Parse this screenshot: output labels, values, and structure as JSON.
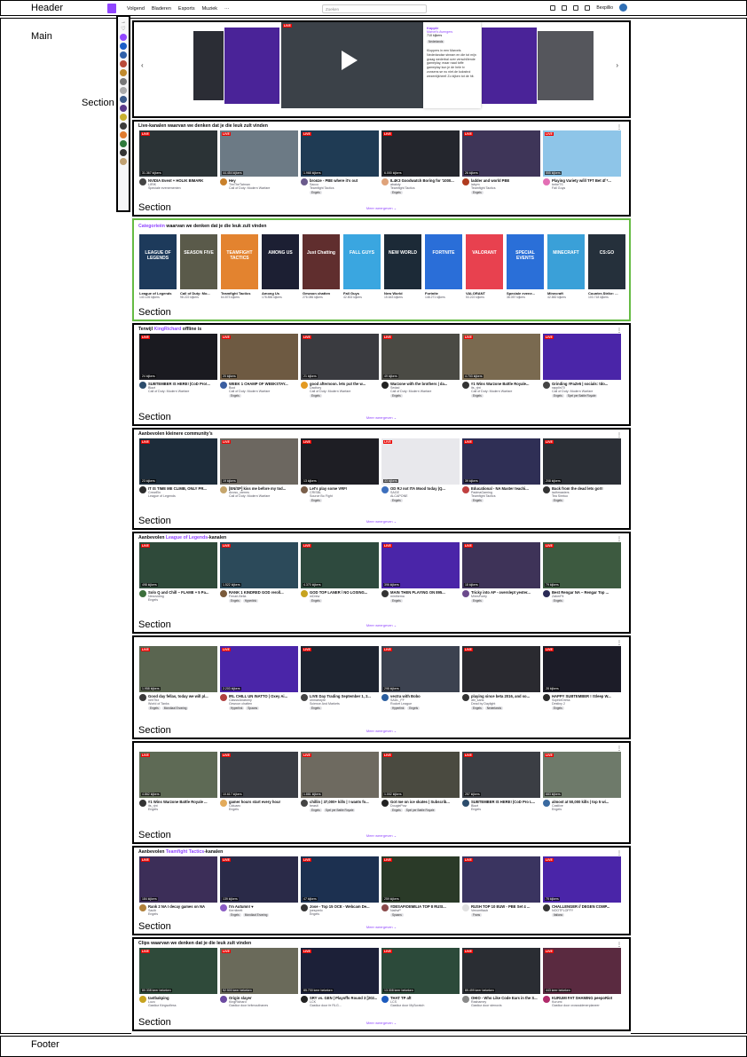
{
  "labels": {
    "header": "Header",
    "main": "Main",
    "footer": "Footer",
    "section": "Section"
  },
  "nav": {
    "items": [
      "Volgend",
      "Bladeren",
      "Esports",
      "Muziek",
      "···"
    ],
    "search_placeholder": "Zoeken",
    "user": "Bexpillio"
  },
  "carousel": {
    "streamer": "Kapple",
    "game": "Marvel's Avengers",
    "viewers": "710 kijkers",
    "tag": "Nederlands",
    "description": "Kloppers in een Marvels Nederlandse stream en die tot mijn graag wederbal over verschillende gameplay, maar raad toffe gameplay kun je de hele tv zonsens se nu niet.de kolostroi wezenlijkheel! Zo kijken tot de hit."
  },
  "sections": [
    {
      "title_pre": "Live-kanalen waarvan we denken dat je die leuk zult vinden",
      "title_hl": "",
      "title_post": "",
      "more": "Meer weergeven",
      "cards": [
        {
          "viewers": "31.367 kijkers",
          "title": "NVIDIA Event + HOLIK BIMARK",
          "channel": "LIRIK",
          "game": "Speciale evenementen",
          "tags": [],
          "color": "#2b3336",
          "av": "#444"
        },
        {
          "viewers": "44.454 kijkers",
          "title": "Hey",
          "channel": "TimTheTatman",
          "game": "Call of Duty: Modern Warfare",
          "tags": [],
          "color": "#6c7a85",
          "av": "#c9812c"
        },
        {
          "viewers": "1.968 kijkers",
          "title": "bronze - PBE where it's out",
          "channel": "Sacco",
          "game": "Teamfight Tactics",
          "tags": [
            "Engels"
          ],
          "color": "#1f3b54",
          "av": "#6a5a8c"
        },
        {
          "viewers": "6.000 kijkers",
          "title": "IL4K3 Goodwatch Boring for '1000...",
          "channel": "abakdy",
          "game": "Teamfight Tactics",
          "tags": [
            "Engels"
          ],
          "color": "#24262d",
          "av": "#dfa37a"
        },
        {
          "viewers": "26 kijkers",
          "title": "ladder and world PBE",
          "channel": "labym",
          "game": "Teamfight Tactics",
          "tags": [
            "Engels"
          ],
          "color": "#3e3558",
          "av": "#b03b1f"
        },
        {
          "viewers": "555 kijkers",
          "title": "Playing Variety w/ill TFT Bet 4f *...",
          "channel": "bebeTS",
          "game": "Fall Guys",
          "tags": [],
          "color": "#8ec5e8",
          "av": "#e36fb5"
        }
      ]
    }
  ],
  "categories": {
    "title_hl": "Categorieën",
    "title_post": " waarvan we denken dat je die leuk zult vinden",
    "items": [
      {
        "name": "League of Legends",
        "viewers": "140.126 kijkers",
        "color": "#1d3a5b",
        "art": "LEAGUE OF LEGENDS"
      },
      {
        "name": "Call of Duty: Mo...",
        "viewers": "98.222 kijkers",
        "color": "#5a5a4a",
        "art": "SEASON FIVE"
      },
      {
        "name": "Teamfight Tactics",
        "viewers": "64.873 kijkers",
        "color": "#e3832f",
        "art": "TEAMFIGHT TACTICS"
      },
      {
        "name": "Among Us",
        "viewers": "178.856 kijkers",
        "color": "#1c1f33",
        "art": "AMONG US"
      },
      {
        "name": "Gewoon chatten",
        "viewers": "276.086 kijkers",
        "color": "#602e2e",
        "art": "Just Chatting"
      },
      {
        "name": "Fall Guys",
        "viewers": "42.802 kijkers",
        "color": "#3aa6e0",
        "art": "FALL GUYS"
      },
      {
        "name": "New World",
        "viewers": "15.643 kijkers",
        "color": "#1c2a37",
        "art": "NEW WORLD"
      },
      {
        "name": "Fortnite",
        "viewers": "148.271 kijkers",
        "color": "#2a6ed8",
        "art": "FORTNITE"
      },
      {
        "name": "VALORANT",
        "viewers": "53.222 kijkers",
        "color": "#e8414f",
        "art": "VALORANT"
      },
      {
        "name": "Speciale evene...",
        "viewers": "38.057 kijkers",
        "color": "#2a6fd8",
        "art": "SPECIAL EVENTS"
      },
      {
        "name": "Minecraft",
        "viewers": "42.882 kijkers",
        "color": "#3aa0d8",
        "art": "MINECRAFT"
      },
      {
        "name": "Counter-Strike: ...",
        "viewers": "103.718 kijkers",
        "color": "#25303b",
        "art": "CS:GO"
      }
    ]
  },
  "rows": [
    {
      "title_pre": "Terwijl ",
      "title_hl": "KingRichard",
      "title_post": " offline is",
      "more": "Meer weergeven",
      "cards": [
        {
          "viewers": "24 kijkers",
          "title": "SUBTEMBER IS HERE! |CoD Pro!...",
          "channel": "Biazt",
          "game": "Call of Duty: Modern Warfare",
          "tags": [],
          "color": "#1a1a20",
          "av": "#2c4c6c"
        },
        {
          "viewers": "20 kijkers",
          "title": "WEEK 1 CHAMP OF WEEKSTAY...",
          "channel": "Booi",
          "game": "Call of Duty: Modern Warfare",
          "tags": [
            "Engels"
          ],
          "color": "#6e5a42",
          "av": "#3a5ea0"
        },
        {
          "viewers": "21 kijkers",
          "title": "good afternoon. lets put the w...",
          "channel": "Dacitory",
          "game": "Call of Duty: Modern Warfare",
          "tags": [
            "Engels"
          ],
          "color": "#3a3b40",
          "av": "#e39a22"
        },
        {
          "viewers": "49 kijkers",
          "title": "Warzone with the brothers | da...",
          "channel": "Sedad",
          "game": "Call of Duty: Modern Warfare",
          "tags": [
            "Engels"
          ],
          "color": "#4a4a44",
          "av": "#222"
        },
        {
          "viewers": "4.703 kijkers",
          "title": "#1 Wins Warzone Battle Royale...",
          "channel": "its_rjnt",
          "game": "Call of Duty: Modern Warfare",
          "tags": [
            "Engels"
          ],
          "color": "#7a6a50",
          "av": "#333"
        },
        {
          "viewers": "",
          "title": "Grinding #FaZe5 | socials: tdo...",
          "channel": "rapplin70",
          "game": "Call of Duty: Modern Warfare",
          "tags": [
            "Engels",
            "Spel per Battle Royale"
          ],
          "color": "#4a25a8",
          "av": "#444"
        }
      ]
    },
    {
      "title_pre": "Aanbevolen kleinere community's",
      "title_hl": "",
      "title_post": "",
      "more": "Meer weergeven",
      "cards": [
        {
          "viewers": "23 kijkers",
          "title": "IT IS TIME ME CLIMB, ONLY PR...",
          "channel": "CrearEin",
          "game": "League of Legends",
          "tags": [],
          "color": "#1d2c3a",
          "av": "#2b2b2b"
        },
        {
          "viewers": "19 kijkers",
          "title": "[EN/SP] kiss me before my tod...",
          "channel": "Anosu_xterms",
          "game": "Call of Duty: Modern Warfare",
          "tags": [],
          "color": "#6c6760",
          "av": "#c5a56c"
        },
        {
          "viewers": "13 kijkers",
          "title": "Let's play some VRF!",
          "channel": "CRISBL",
          "game": "Source Bo Fight",
          "tags": [
            "Engels"
          ],
          "color": "#1e1e24",
          "av": "#7a5f4a"
        },
        {
          "viewers": "33 kijkers",
          "title": "OD RJ not ITA Mood today (Q...",
          "channel": "SAGE",
          "game": "ALCAPONE",
          "tags": [
            "Engels"
          ],
          "color": "#e8e8ec",
          "av": "#3d6fbd"
        },
        {
          "viewers": "39 kijkers",
          "title": "Educational - NA Master teachi...",
          "channel": "PadmaGaming",
          "game": "Teamfight Tactics",
          "tags": [
            "Engels"
          ],
          "color": "#2f2f55",
          "av": "#c04040"
        },
        {
          "viewers": "208 kijkers",
          "title": "Back from the dead lets go!!!",
          "channel": "iadhmasters",
          "game": "Tea Simtuo",
          "tags": [
            "Engels"
          ],
          "color": "#2b2f36",
          "av": "#333"
        }
      ]
    },
    {
      "title_pre": "Aanbevolen ",
      "title_hl": "League of Legends",
      "title_post": "-kanalen",
      "more": "Meer weergeven",
      "cards": [
        {
          "viewers": "498 kijkers",
          "title": "Solo Q and Chill ~ FLAME + 5 Pa...",
          "channel": "Nexoviding",
          "game": "Engels",
          "tags": [],
          "color": "#2f4a3a",
          "av": "#3c6f3c"
        },
        {
          "viewers": "1.522 kijkers",
          "title": "RANK 1 KINDRED GOD reroll...",
          "channel": "Fenari-Bella",
          "game": "",
          "tags": [
            "Engels",
            "Hyperlink"
          ],
          "color": "#2c4a5a",
          "av": "#7a5a3a"
        },
        {
          "viewers": "4.370 kijkers",
          "title": "GOD TOP LANER / NO LOSING...",
          "channel": "mDrew",
          "game": "",
          "tags": [
            "Engels"
          ],
          "color": "#2e4a3e",
          "av": "#c7a31f"
        },
        {
          "viewers": "396 kijkers",
          "title": "MAIN THEN PLAYING ON 895...",
          "channel": "minthema",
          "game": "",
          "tags": [
            "Engels"
          ],
          "color": "#4a25a8",
          "av": "#333"
        },
        {
          "viewers": "18 kijkers",
          "title": "Tricky into AP - overslept yester...",
          "channel": "MiresPoety",
          "game": "",
          "tags": [
            "Engels"
          ],
          "color": "#3e3358",
          "av": "#6b4a8c"
        },
        {
          "viewers": "79 kijkers",
          "title": "Best Rengar NA ~ Rengar Top ...",
          "channel": "ZaberFit",
          "game": "",
          "tags": [
            "Engels"
          ],
          "color": "#3d5a40",
          "av": "#2a2a55"
        }
      ]
    },
    {
      "title_pre": "",
      "title_hl": "",
      "title_post": "",
      "more": "Meer weergeven",
      "cards": [
        {
          "viewers": "1.958 kijkers",
          "title": "Good day fellas, today we will pl...",
          "channel": "nehTtrz",
          "game": "World of Tanks",
          "tags": [
            "Engels",
            "Mondiaal Ervaring"
          ],
          "color": "#5a6550",
          "av": "#3a3a3a"
        },
        {
          "viewers": "2.203 kijkers",
          "title": "IRL CHILL UN INATTO | Oxey Ai...",
          "channel": "ClassicAnatomy",
          "game": "Gewoon chatten",
          "tags": [
            "Hyperlink",
            "Spaans"
          ],
          "color": "#4a25a8",
          "av": "#b04040"
        },
        {
          "viewers": "",
          "title": "LIVE Day Trading September 1, 2...",
          "channel": "ohmarstyre",
          "game": "Science And Markets",
          "tags": [
            "Engels"
          ],
          "color": "#1e2430",
          "av": "#444"
        },
        {
          "viewers": "298 kijkers",
          "title": "vectra with Bobo",
          "channel": "SADL_FF",
          "game": "Rocket League",
          "tags": [
            "Hyperlink",
            "Engels"
          ],
          "color": "#3c4250",
          "av": "#2a5ea0"
        },
        {
          "viewers": "",
          "title": "playing since beta 2016, and so...",
          "channel": "dbl_sans",
          "game": "Dead by Daylight",
          "tags": [
            "Engels",
            "Nederlands"
          ],
          "color": "#2a2a30",
          "av": "#333"
        },
        {
          "viewers": "28 kijkers",
          "title": "HAPPY SUBTEMBER ! !Sleep W...",
          "channel": "SophieDress",
          "game": "Destiny 2",
          "tags": [
            "Engels"
          ],
          "color": "#1c1c28",
          "av": "#2a2a2a"
        }
      ]
    },
    {
      "title_pre": "",
      "title_hl": "",
      "title_post": "",
      "more": "Meer weergeven",
      "cards": [
        {
          "viewers": "4.862 kijkers",
          "title": "#1 Wins Warzone Battle Royale ...",
          "channel": "its_rjnt",
          "game": "Engels",
          "tags": [],
          "color": "#5e6a55",
          "av": "#333"
        },
        {
          "viewers": "10.617 kijkers",
          "title": "gamer hours start every hour",
          "channel": "Ciduaec",
          "game": "Engels",
          "tags": [],
          "color": "#3a3d44",
          "av": "#e3ab5c"
        },
        {
          "viewers": "1.881 kijkers",
          "title": "chillin | 37,000+ kills | ! wants fo...",
          "channel": "beasit",
          "game": "",
          "tags": [
            "Engels",
            "Spel per Battle Royale"
          ],
          "color": "#6e6a60",
          "av": "#444"
        },
        {
          "viewers": "1.002 kijkers",
          "title": "Got me on ice skates | Subscrib...",
          "channel": "DougiePow",
          "game": "",
          "tags": [
            "Engels",
            "Spel per Battle Royale"
          ],
          "color": "#4a4a40",
          "av": "#222"
        },
        {
          "viewers": "257 kijkers",
          "title": "SUBTEMBER IS HERE! |CoD Pro L...",
          "channel": "Biazt",
          "game": "Engels",
          "tags": [],
          "color": "#3b3e44",
          "av": "#2c4c6c"
        },
        {
          "viewers": "683 kijkers",
          "title": "almost at 50,000 kills | top 5 wi...",
          "channel": "Castlive",
          "game": "Engels",
          "tags": [],
          "color": "#6e7a6a",
          "av": "#3a6aa0"
        }
      ]
    },
    {
      "title_pre": "Aanbevolen ",
      "title_hl": "Teamfight Tactics",
      "title_post": "-kanalen",
      "more": "Meer weergeven",
      "cards": [
        {
          "viewers": "184 kijkers",
          "title": "Rank 2 NA I decay games on NA",
          "channel": "Sacib",
          "game": "Engels",
          "tags": [],
          "color": "#3c2e58",
          "av": "#b0803a"
        },
        {
          "viewers": "139 kijkers",
          "title": "I'm Autumn! ♥",
          "channel": "Kerniteett",
          "game": "",
          "tags": [
            "Engels",
            "Mondiaal Ervaring"
          ],
          "color": "#2a2a48",
          "av": "#8a5cc4"
        },
        {
          "viewers": "47 kijkers",
          "title": "Jose - Top 15 OCE - Webcam De...",
          "channel": "joesprelo",
          "game": "Engels",
          "tags": [],
          "color": "#1c3050",
          "av": "#333"
        },
        {
          "viewers": "259 kijkers",
          "title": "#DESAFIOEMILIA TOP 8 RUSI...",
          "channel": "NathvP",
          "game": "",
          "tags": [
            "Spaans"
          ],
          "color": "#2a3a28",
          "av": "#8a4a4a"
        },
        {
          "viewers": "",
          "title": "RUSH TOP 10 EUW - PBE Set 4 ...",
          "channel": "Venomftaub",
          "game": "",
          "tags": [
            "Frans"
          ],
          "color": "#3a3460",
          "av": "#e0e0e0"
        },
        {
          "viewers": "75 kijkers",
          "title": "CHALLENGER // DEGEN COMP...",
          "channel": "NOOTFLOFFY",
          "game": "",
          "tags": [
            "Italiano"
          ],
          "color": "#4a25a8",
          "av": "#333"
        }
      ]
    },
    {
      "title_pre": "Clips waarvan we denken dat je die leuk zult vinden",
      "title_hl": "",
      "title_post": "",
      "more": "Meer weergeven",
      "cards": [
        {
          "viewers": "80.338 keer bekeken",
          "title": "tastbakping",
          "channel": "Lozo",
          "game": "Gastloz Kingsofless",
          "tags": [],
          "color": "#2f4a3a",
          "av": "#c7a31f"
        },
        {
          "viewers": "52.500 keer bekeken",
          "title": "Origin slayer",
          "channel": "KingRichard",
          "game": "Gastloz door britmouthanes",
          "tags": [],
          "color": "#6a6a5a",
          "av": "#6b4aa0"
        },
        {
          "viewers": "85.730 keer bekeken",
          "title": "SRY vs. GEN | Playoffs Round 3 [202...",
          "channel": "LCK",
          "game": "Gastloz door fe RLG...",
          "tags": [],
          "color": "#1c2038",
          "av": "#222"
        },
        {
          "viewers": "13.308 keer bekeken",
          "title": "THAT TP aft",
          "channel": "LCS",
          "game": "Gastloz door MyScratch",
          "tags": [],
          "color": "#2c4a3a",
          "av": "#1c5abd"
        },
        {
          "viewers": "89.499 keer bekeken",
          "title": "OHIO - Who Like Code Ears in the S...",
          "channel": "Rashamey",
          "game": "Gastloz door stenoxis",
          "tags": [],
          "color": "#2a2d33",
          "av": "#888"
        },
        {
          "viewers": "443 keer bekeken",
          "title": "KURUMI FAT SHAMING peepoRiot",
          "channel": "Kurumi",
          "game": "Gastloz door crosssidenerplaneer",
          "tags": [],
          "color": "#5a2a40",
          "av": "#b02a6a"
        }
      ]
    }
  ],
  "live_label": "LIVE",
  "sidebar_avatars": [
    "#9146ff",
    "#1a5ec8",
    "#2e5fa8",
    "#b84a3a",
    "#c08a2e",
    "#777",
    "#aaa",
    "#3a5a8a",
    "#5a3a8a",
    "#c8b02e",
    "#3a3a3a",
    "#e07a2e",
    "#2e7a3a",
    "#333",
    "#c0a070"
  ]
}
